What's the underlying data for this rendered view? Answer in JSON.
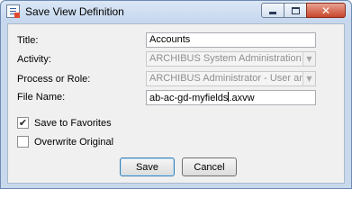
{
  "window": {
    "title": "Save View Definition",
    "minimize_symbol": "",
    "maximize_symbol": "",
    "close_symbol": "✕"
  },
  "form": {
    "title_label": "Title:",
    "title_value": "Accounts",
    "activity_label": "Activity:",
    "activity_value": "ARCHIBUS System Administration",
    "process_label": "Process or Role:",
    "process_value": "ARCHIBUS Administrator - User and Secu...",
    "filename_label": "File Name:",
    "filename_before_cursor": "ab-ac-gd-myfields",
    "filename_after_cursor": ".axvw",
    "save_favorites_label": "Save to Favorites",
    "save_favorites_checked": true,
    "overwrite_label": "Overwrite Original",
    "overwrite_checked": false
  },
  "buttons": {
    "save": "Save",
    "cancel": "Cancel"
  },
  "icons": {
    "app": "document-form-icon",
    "dropdown": "chevron-down-icon",
    "check": "✔"
  },
  "colors": {
    "frame": "#c9d9ec",
    "close_button": "#c8462c",
    "disabled_text": "#8f8f8f"
  }
}
